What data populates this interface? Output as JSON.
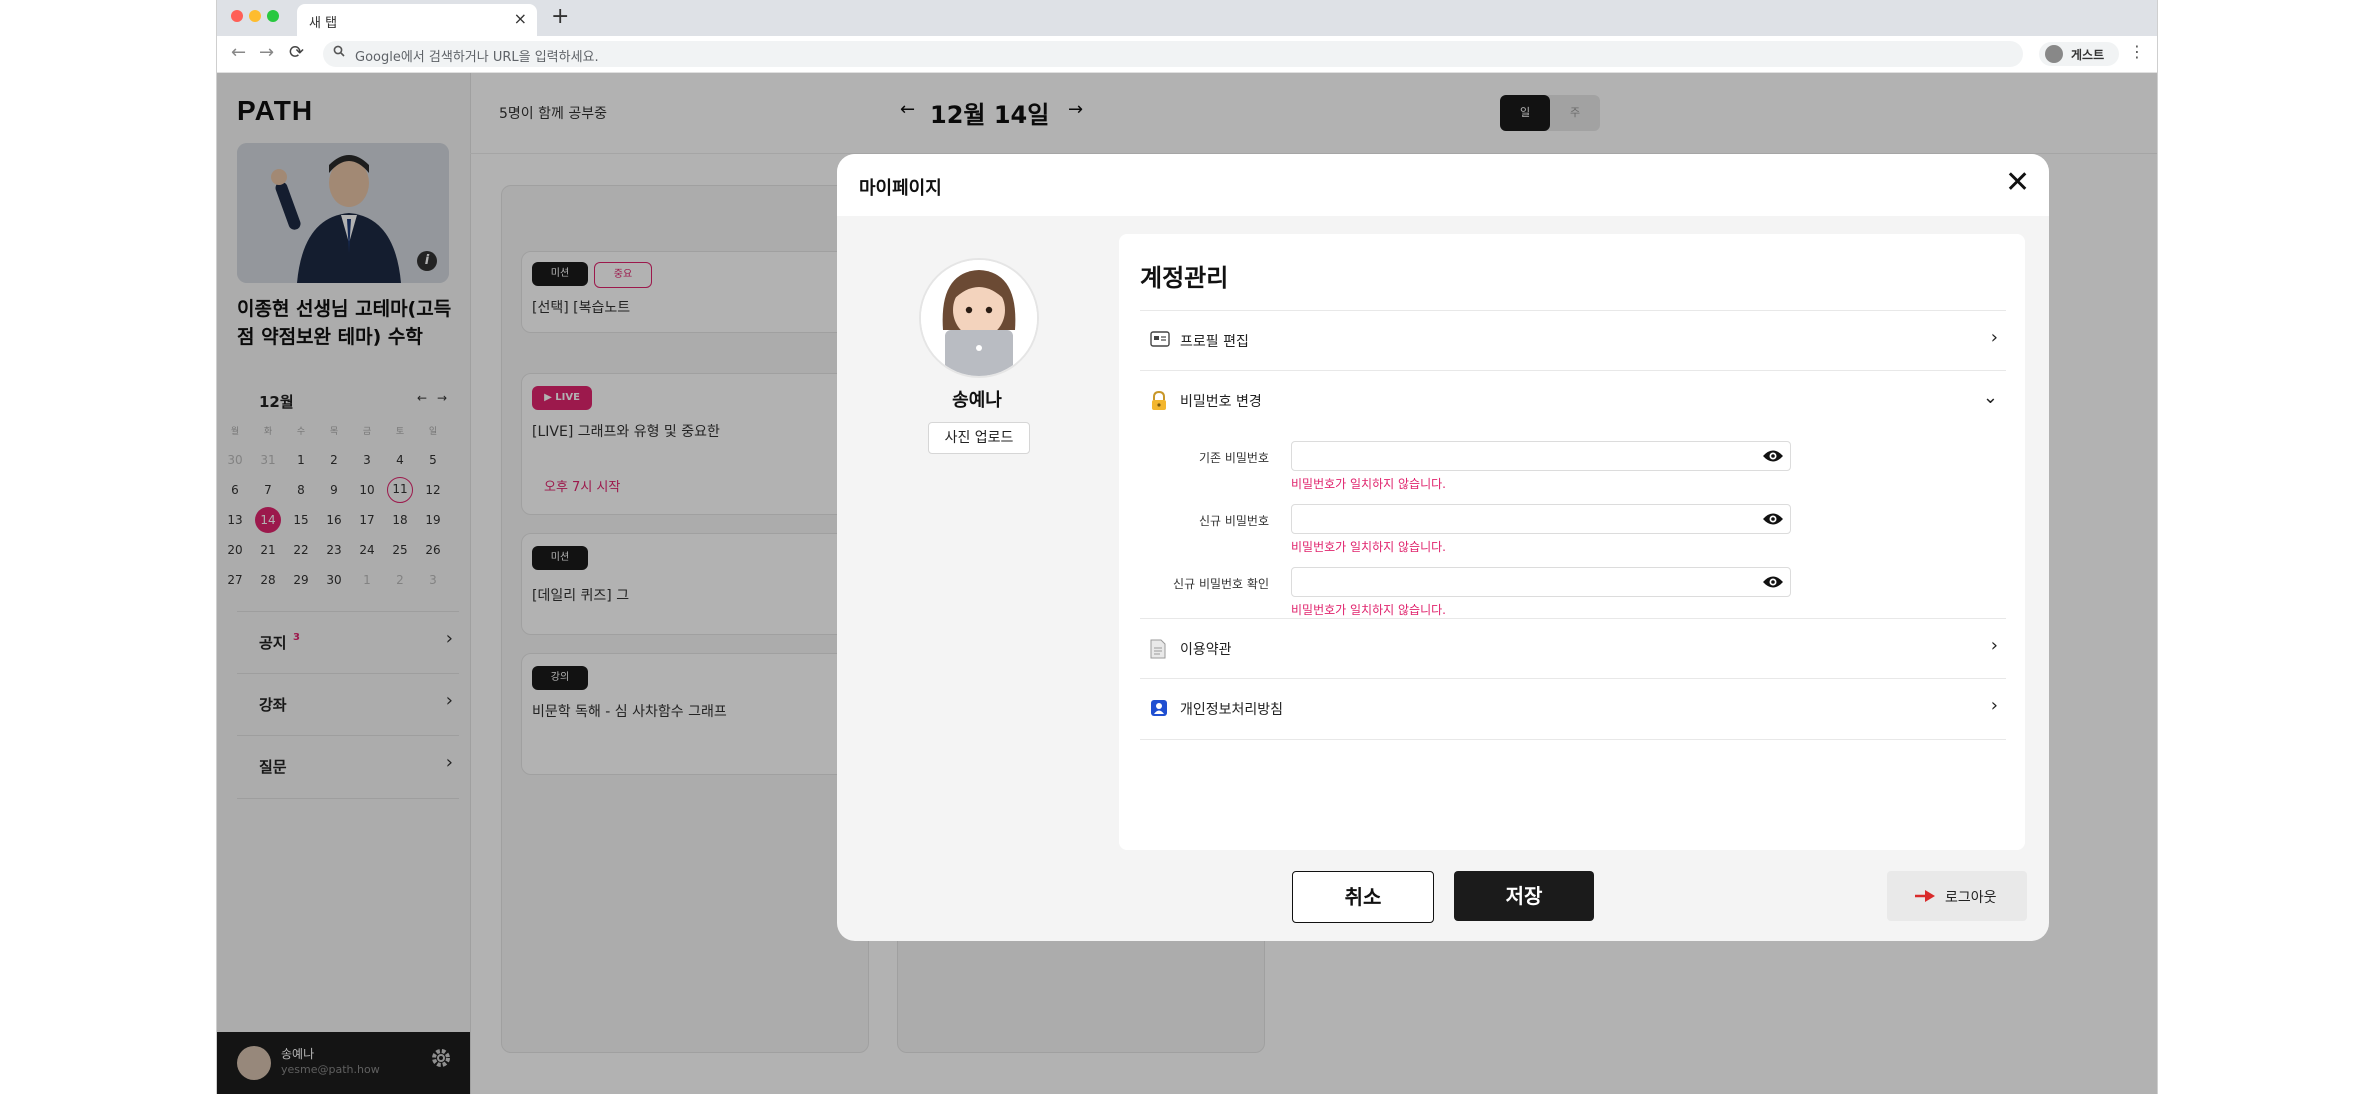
{
  "browser": {
    "tab_title": "새 탭",
    "tab_close": "×",
    "new_tab": "+",
    "omnibox_placeholder": "Google에서 검색하거나 URL을 입력하세요.",
    "profile_label": "게스트",
    "nav_back": "←",
    "nav_forward": "→",
    "nav_reload": "⟳",
    "menu": "⋮"
  },
  "sidebar": {
    "logo": "PATH",
    "course_title": "이종현 선생님 고테마(고득점 약점보완 테마) 수학",
    "info": "i",
    "calendar": {
      "month": "12월",
      "prev": "←",
      "next": "→",
      "weekdays": [
        "월",
        "화",
        "수",
        "목",
        "금",
        "토",
        "일"
      ],
      "weeks": [
        [
          "30",
          "31",
          "1",
          "2",
          "3",
          "4",
          "5"
        ],
        [
          "6",
          "7",
          "8",
          "9",
          "10",
          "11",
          "12"
        ],
        [
          "13",
          "14",
          "15",
          "16",
          "17",
          "18",
          "19"
        ],
        [
          "20",
          "21",
          "22",
          "23",
          "24",
          "25",
          "26"
        ],
        [
          "27",
          "28",
          "29",
          "30",
          "1",
          "2",
          "3"
        ]
      ],
      "selected": "14",
      "today_outline": "11"
    },
    "menu": [
      {
        "label": "공지",
        "badge": "3"
      },
      {
        "label": "강좌"
      },
      {
        "label": "질문"
      }
    ],
    "user": {
      "name": "송예나",
      "email": "yesme@path.how"
    }
  },
  "main": {
    "studying": "5명이 함께 공부중",
    "date": "12월 14일",
    "prev": "←",
    "next": "→",
    "view_tabs": [
      "일",
      "주"
    ],
    "cards": [
      {
        "tag": "미션",
        "tag2": "중요",
        "text": "[선택] [복습노트"
      },
      {
        "tag": "▶ LIVE",
        "text": "[LIVE] 그래프와 유형 및 중요한",
        "time": "오후 7시 시작"
      },
      {
        "tag": "미션",
        "text": "[데일리 퀴즈] 그"
      },
      {
        "tag": "강의",
        "text": "비문학 독해 - 심 사차함수 그래프"
      }
    ]
  },
  "modal": {
    "title": "마이페이지",
    "close": "✕",
    "profile_name": "송예나",
    "upload_label": "사진 업로드",
    "section_title": "계정관리",
    "rows": {
      "profile_edit": "프로필 편집",
      "password_change": "비밀번호 변경",
      "terms": "이용약관",
      "privacy": "개인정보처리방침"
    },
    "password_fields": [
      {
        "label": "기존 비밀번호",
        "value": "",
        "error": "비밀번호가 일치하지 않습니다."
      },
      {
        "label": "신규 비밀번호",
        "value": "",
        "error": "비밀번호가 일치하지 않습니다."
      },
      {
        "label": "신규 비밀번호 확인",
        "value": "",
        "error": "비밀번호가 일치하지 않습니다."
      }
    ],
    "cancel": "취소",
    "save": "저장",
    "logout": "로그아웃"
  },
  "colors": {
    "accent": "#e0246d",
    "dark": "#1b1b1b",
    "logout_arrow": "#d92b2b"
  }
}
